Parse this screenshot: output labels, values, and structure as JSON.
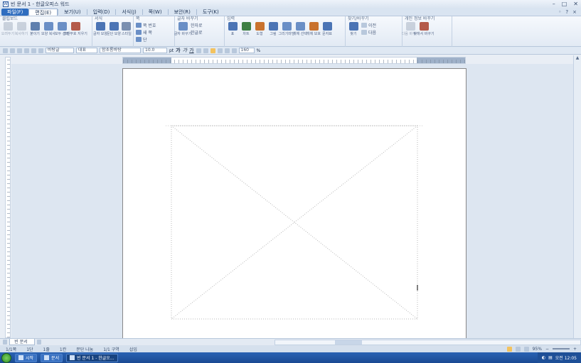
{
  "titlebar": {
    "title": "빈 문서 1 - 한글오피스 워드",
    "app_icon": "W",
    "controls": [
      "–",
      "□",
      "✕"
    ]
  },
  "menubar": {
    "items": [
      "파일(F)",
      "편집(E)",
      "보기(U)",
      "입력(D)",
      "서식(J)",
      "쪽(W)",
      "보안(R)",
      "도구(K)"
    ],
    "right": [
      "◦",
      "?",
      "×"
    ]
  },
  "ribbon": {
    "groups": [
      {
        "title": "클립보드",
        "tools": [
          {
            "label": "오려두기",
            "icon": "cut-icon",
            "color": "#9aa6b8",
            "disabled": true
          },
          {
            "label": "복사하기",
            "icon": "copy-icon",
            "color": "#9aa6b8",
            "disabled": true
          },
          {
            "label": "붙이기",
            "icon": "paste-icon",
            "color": "#5e7fae"
          },
          {
            "label": "모양 복사",
            "icon": "format-copy-icon",
            "color": "#6a8fc6"
          },
          {
            "label": "모두 선택",
            "icon": "select-all-icon",
            "color": "#6a8fc6"
          },
          {
            "label": "조판부호 지우기",
            "icon": "erase-icon",
            "color": "#b45a4a"
          }
        ]
      },
      {
        "title": "서식",
        "tools": [
          {
            "label": "글자 모양",
            "icon": "char-shape-icon",
            "color": "#4b74b5"
          },
          {
            "label": "문단 모양",
            "icon": "para-shape-icon",
            "color": "#4b74b5"
          },
          {
            "label": "스타일",
            "icon": "style-icon",
            "color": "#7a8fb0"
          }
        ]
      },
      {
        "title": "쪽",
        "rows": [
          "쪽 번호",
          "새 쪽",
          "단"
        ]
      },
      {
        "title": "글자 바꾸기",
        "tools": [
          {
            "label": "글자 바꾸기",
            "icon": "char-replace-icon",
            "color": "#6a8fc6"
          }
        ],
        "rows": [
          "한자로",
          "한글로"
        ]
      },
      {
        "title": "입력",
        "tools": [
          {
            "label": "표",
            "icon": "table-icon",
            "color": "#4b74b5"
          },
          {
            "label": "차트",
            "icon": "chart-icon",
            "color": "#3d7f44"
          },
          {
            "label": "도형",
            "icon": "shape-icon",
            "color": "#c9722e"
          },
          {
            "label": "그림",
            "icon": "picture-icon",
            "color": "#4b74b5"
          },
          {
            "label": "그리기마당",
            "icon": "clipart-icon",
            "color": "#6a8fc6"
          },
          {
            "label": "개체 선택",
            "icon": "object-select-icon",
            "color": "#6a8fc6"
          },
          {
            "label": "개체 보호",
            "icon": "object-protect-icon",
            "color": "#c9722e"
          },
          {
            "label": "문자표",
            "icon": "symbol-icon",
            "color": "#4b74b5"
          }
        ]
      },
      {
        "title": "찾기/바꾸기",
        "tools": [
          {
            "label": "찾기",
            "icon": "find-icon",
            "color": "#4b74b5"
          }
        ],
        "rows": [
          "이전",
          "다음"
        ]
      },
      {
        "title": "개인 정보 바꾸기",
        "tools": [
          {
            "label": "다음 바꾸기",
            "icon": "next-replace-icon",
            "color": "#9aa6b8",
            "disabled": true
          },
          {
            "label": "찾아서 바꾸기",
            "icon": "find-replace-icon",
            "color": "#b45a4a"
          }
        ]
      }
    ]
  },
  "fmtbar": {
    "style": "바탕글",
    "font_lang": "대표",
    "font": "함초롬바탕",
    "size": "10.0",
    "unit": "pt",
    "bold": "가",
    "italic": "가",
    "underline": "가",
    "line_spacing": "160",
    "line_spacing_unit": "%"
  },
  "document": {
    "tab_label": "빈 문서 1"
  },
  "status": {
    "page": "1/1쪽",
    "section": "1단",
    "line": "1줄",
    "column": "1칸",
    "mode": "문단 나눔",
    "section_count": "1/1 구역",
    "insert": "삽입",
    "zoom": "95%"
  },
  "taskbar": {
    "start_label": "시작",
    "buttons": [
      {
        "label": "시작",
        "active": false
      },
      {
        "label": "문서",
        "active": false
      },
      {
        "label": "빈 문서 1 - 한글오...",
        "active": true
      }
    ],
    "clock": "오전 12:05"
  }
}
